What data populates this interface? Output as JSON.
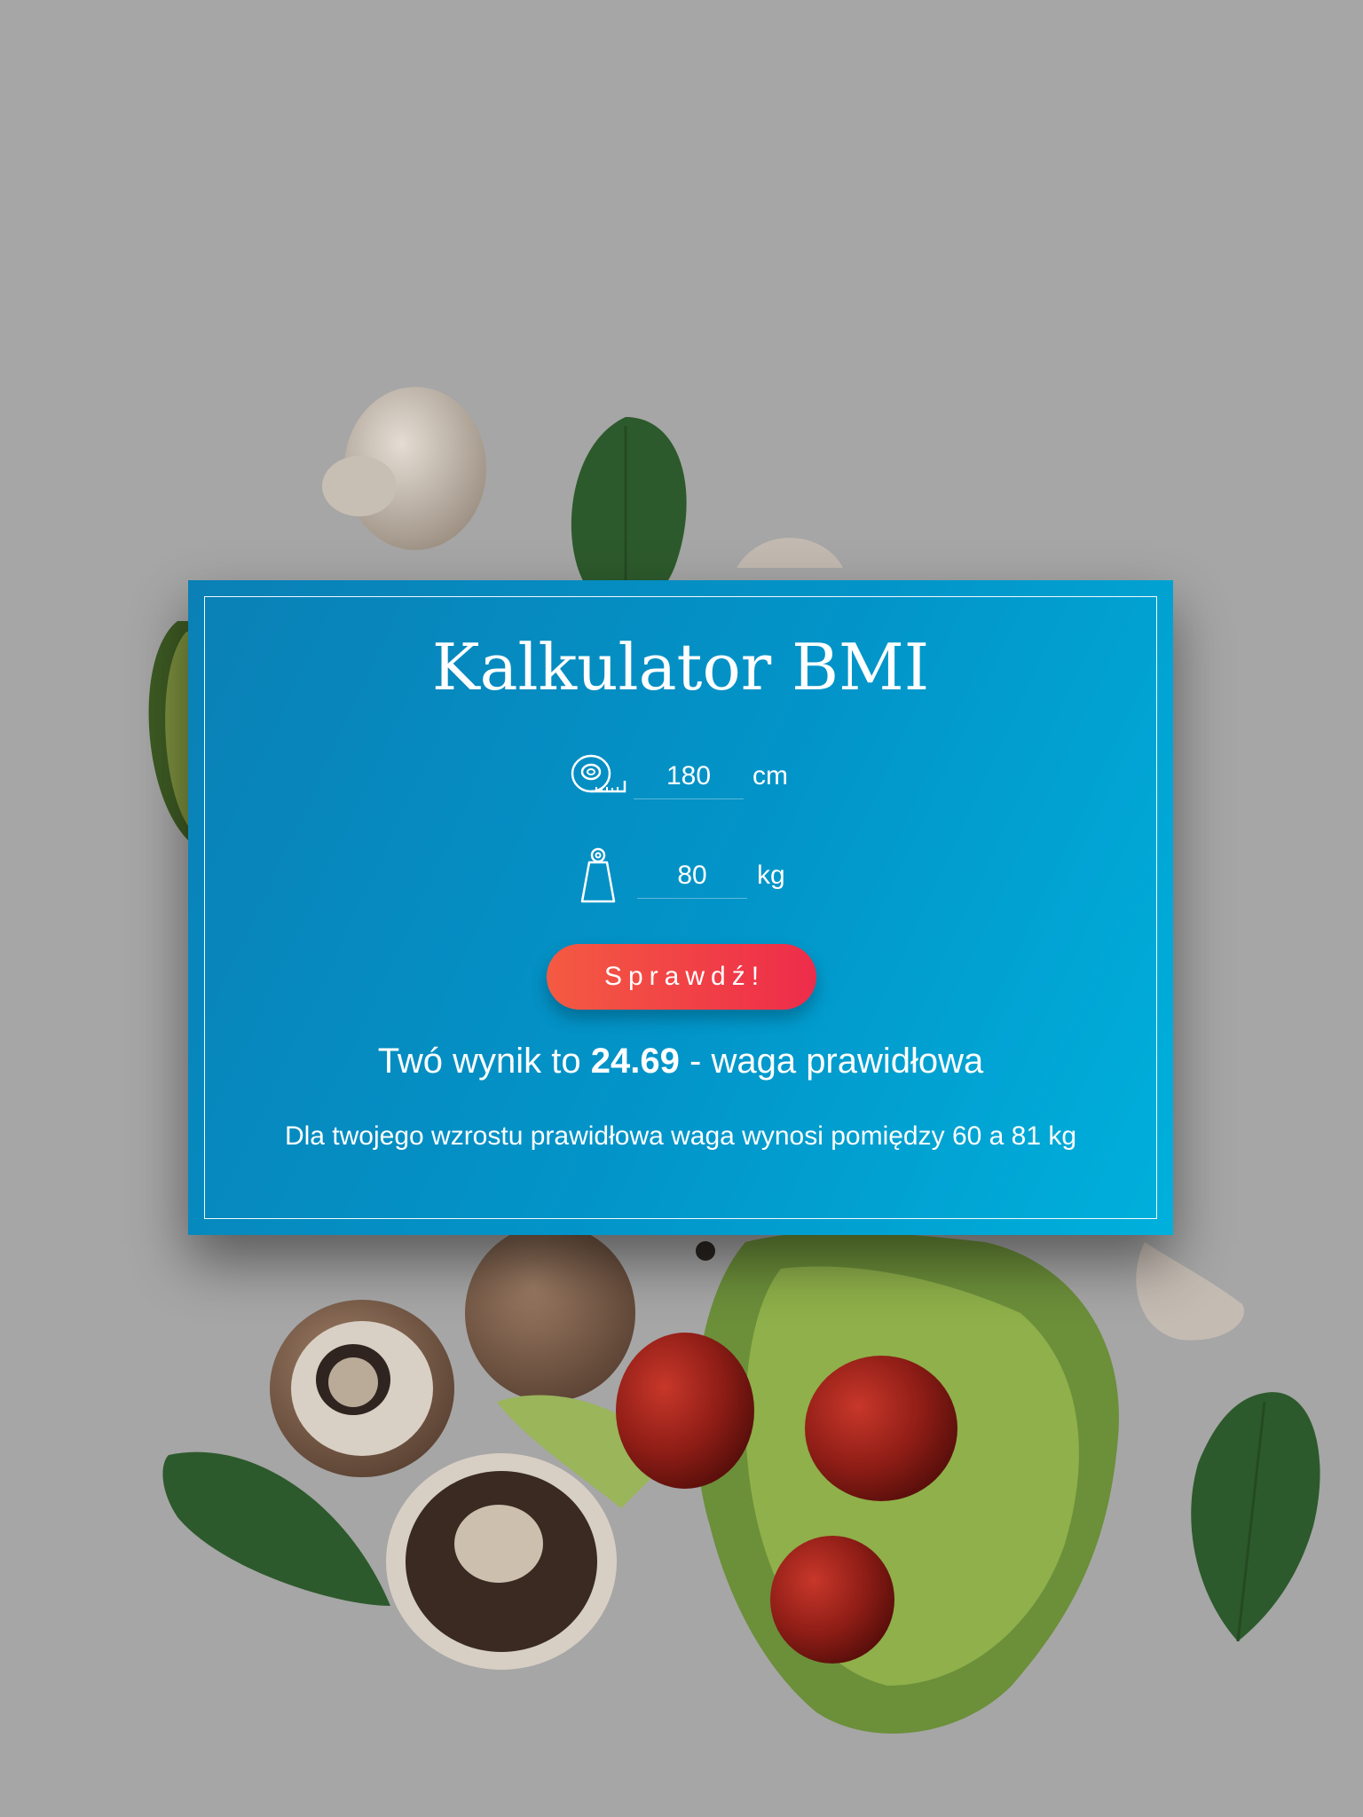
{
  "title": "Kalkulator BMI",
  "height_field": {
    "icon": "tape-measure-icon",
    "value": "180",
    "unit": "cm"
  },
  "weight_field": {
    "icon": "weight-icon",
    "value": "80",
    "unit": "kg"
  },
  "check_button_label": "Sprawdź!",
  "result": {
    "prefix": "Twó wynik to",
    "value": "24.69",
    "suffix": "- waga prawidłowa"
  },
  "range_text": "Dla twojego wzrostu prawidłowa waga wynosi pomiędzy 60 a 81 kg",
  "colors": {
    "card_gradient_start": "#0a80b6",
    "card_gradient_end": "#00b0dc",
    "button_gradient_start": "#f45a42",
    "button_gradient_end": "#ee2c4a",
    "background": "#a6a6a6"
  }
}
